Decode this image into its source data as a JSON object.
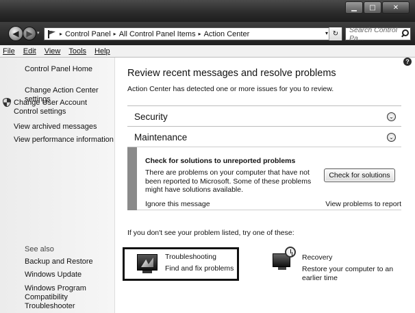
{
  "window": {
    "caption_buttons": {
      "minimize": "▁",
      "maximize": "□",
      "close": "✕"
    }
  },
  "address_bar": {
    "breadcrumbs": [
      "Control Panel",
      "All Control Panel Items",
      "Action Center"
    ],
    "separator": "▸",
    "search_placeholder": "Search Control Pa...",
    "back_glyph": "◀",
    "forward_glyph": "▶",
    "dropdown_glyph": "▾",
    "refresh_glyph": "↻"
  },
  "menu": [
    "File",
    "Edit",
    "View",
    "Tools",
    "Help"
  ],
  "sidebar": {
    "home": "Control Panel Home",
    "links": [
      "Change Action Center settings",
      "Change User Account Control settings",
      "View archived messages",
      "View performance information"
    ],
    "see_also_label": "See also",
    "see_also": [
      "Backup and Restore",
      "Windows Update",
      "Windows Program Compatibility Troubleshooter"
    ]
  },
  "main": {
    "help_glyph": "?",
    "title": "Review recent messages and resolve problems",
    "subtitle": "Action Center has detected one or more issues for you to review.",
    "sections": [
      {
        "label": "Security",
        "expand_glyph": "⌄"
      },
      {
        "label": "Maintenance",
        "expand_glyph": "⌄"
      }
    ],
    "alert": {
      "title": "Check for solutions to unreported problems",
      "body": "There are problems on your computer that have not been reported to Microsoft. Some of these problems might have solutions available.",
      "button": "Check for solutions",
      "ignore": "Ignore this message",
      "view": "View problems to report"
    },
    "try_text": "If you don't see your problem listed, try one of these:",
    "troubleshooting": {
      "title": "Troubleshooting",
      "desc": "Find and fix problems"
    },
    "recovery": {
      "title": "Recovery",
      "desc": "Restore your computer to an earlier time"
    }
  },
  "icons": {
    "flag": "flag-icon",
    "search": "search-icon",
    "shield": "uac-shield-icon",
    "troubleshooting": "troubleshooting-icon",
    "recovery": "recovery-icon"
  }
}
